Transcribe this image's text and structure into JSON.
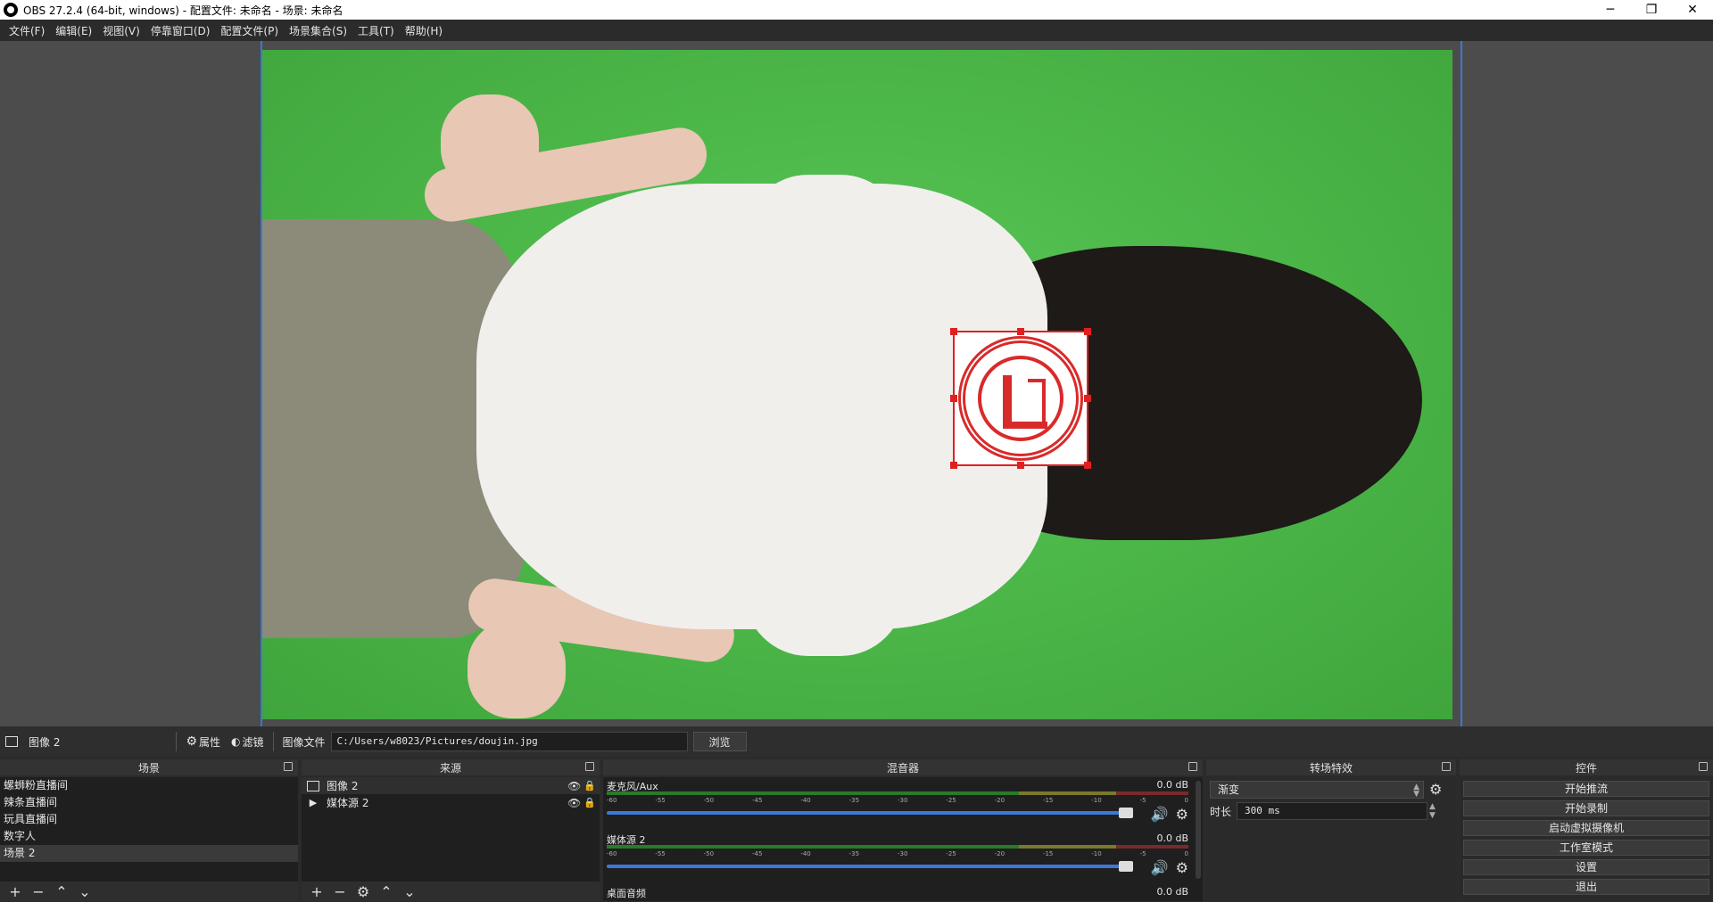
{
  "window": {
    "title": "OBS 27.2.4 (64-bit, windows) - 配置文件: 未命名 - 场景: 未命名",
    "minimize": "─",
    "restore": "❐",
    "close": "✕"
  },
  "menu": [
    "文件(F)",
    "编辑(E)",
    "视图(V)",
    "停靠窗口(D)",
    "配置文件(P)",
    "场景集合(S)",
    "工具(T)",
    "帮助(H)"
  ],
  "source_toolbar": {
    "source_name": "图像 2",
    "properties_label": "属性",
    "filters_label": "滤镜",
    "image_file_label": "图像文件",
    "path_value": "C:/Users/w8023/Pictures/doujin.jpg",
    "browse_label": "浏览"
  },
  "scenes": {
    "title": "场景",
    "items": [
      "螺蛳粉直播间",
      "辣条直播间",
      "玩具直播间",
      "数字人",
      "场景 2"
    ]
  },
  "sources": {
    "title": "来源",
    "items": [
      {
        "name": "图像 2",
        "icon": "image-icon"
      },
      {
        "name": "媒体源 2",
        "icon": "play-icon"
      }
    ]
  },
  "mixer": {
    "title": "混音器",
    "scale": [
      "-60",
      "-55",
      "-50",
      "-45",
      "-40",
      "-35",
      "-30",
      "-25",
      "-20",
      "-15",
      "-10",
      "-5",
      "0"
    ],
    "channels": [
      {
        "name": "麦克风/Aux",
        "db": "0.0 dB"
      },
      {
        "name": "媒体源 2",
        "db": "0.0 dB"
      },
      {
        "name": "桌面音频",
        "db": "0.0 dB"
      }
    ]
  },
  "transitions": {
    "title": "转场特效",
    "selected": "渐变",
    "duration_label": "时长",
    "duration_value": "300 ms"
  },
  "controls": {
    "title": "控件",
    "buttons": [
      "开始推流",
      "开始录制",
      "启动虚拟摄像机",
      "工作室模式",
      "设置",
      "退出"
    ]
  }
}
